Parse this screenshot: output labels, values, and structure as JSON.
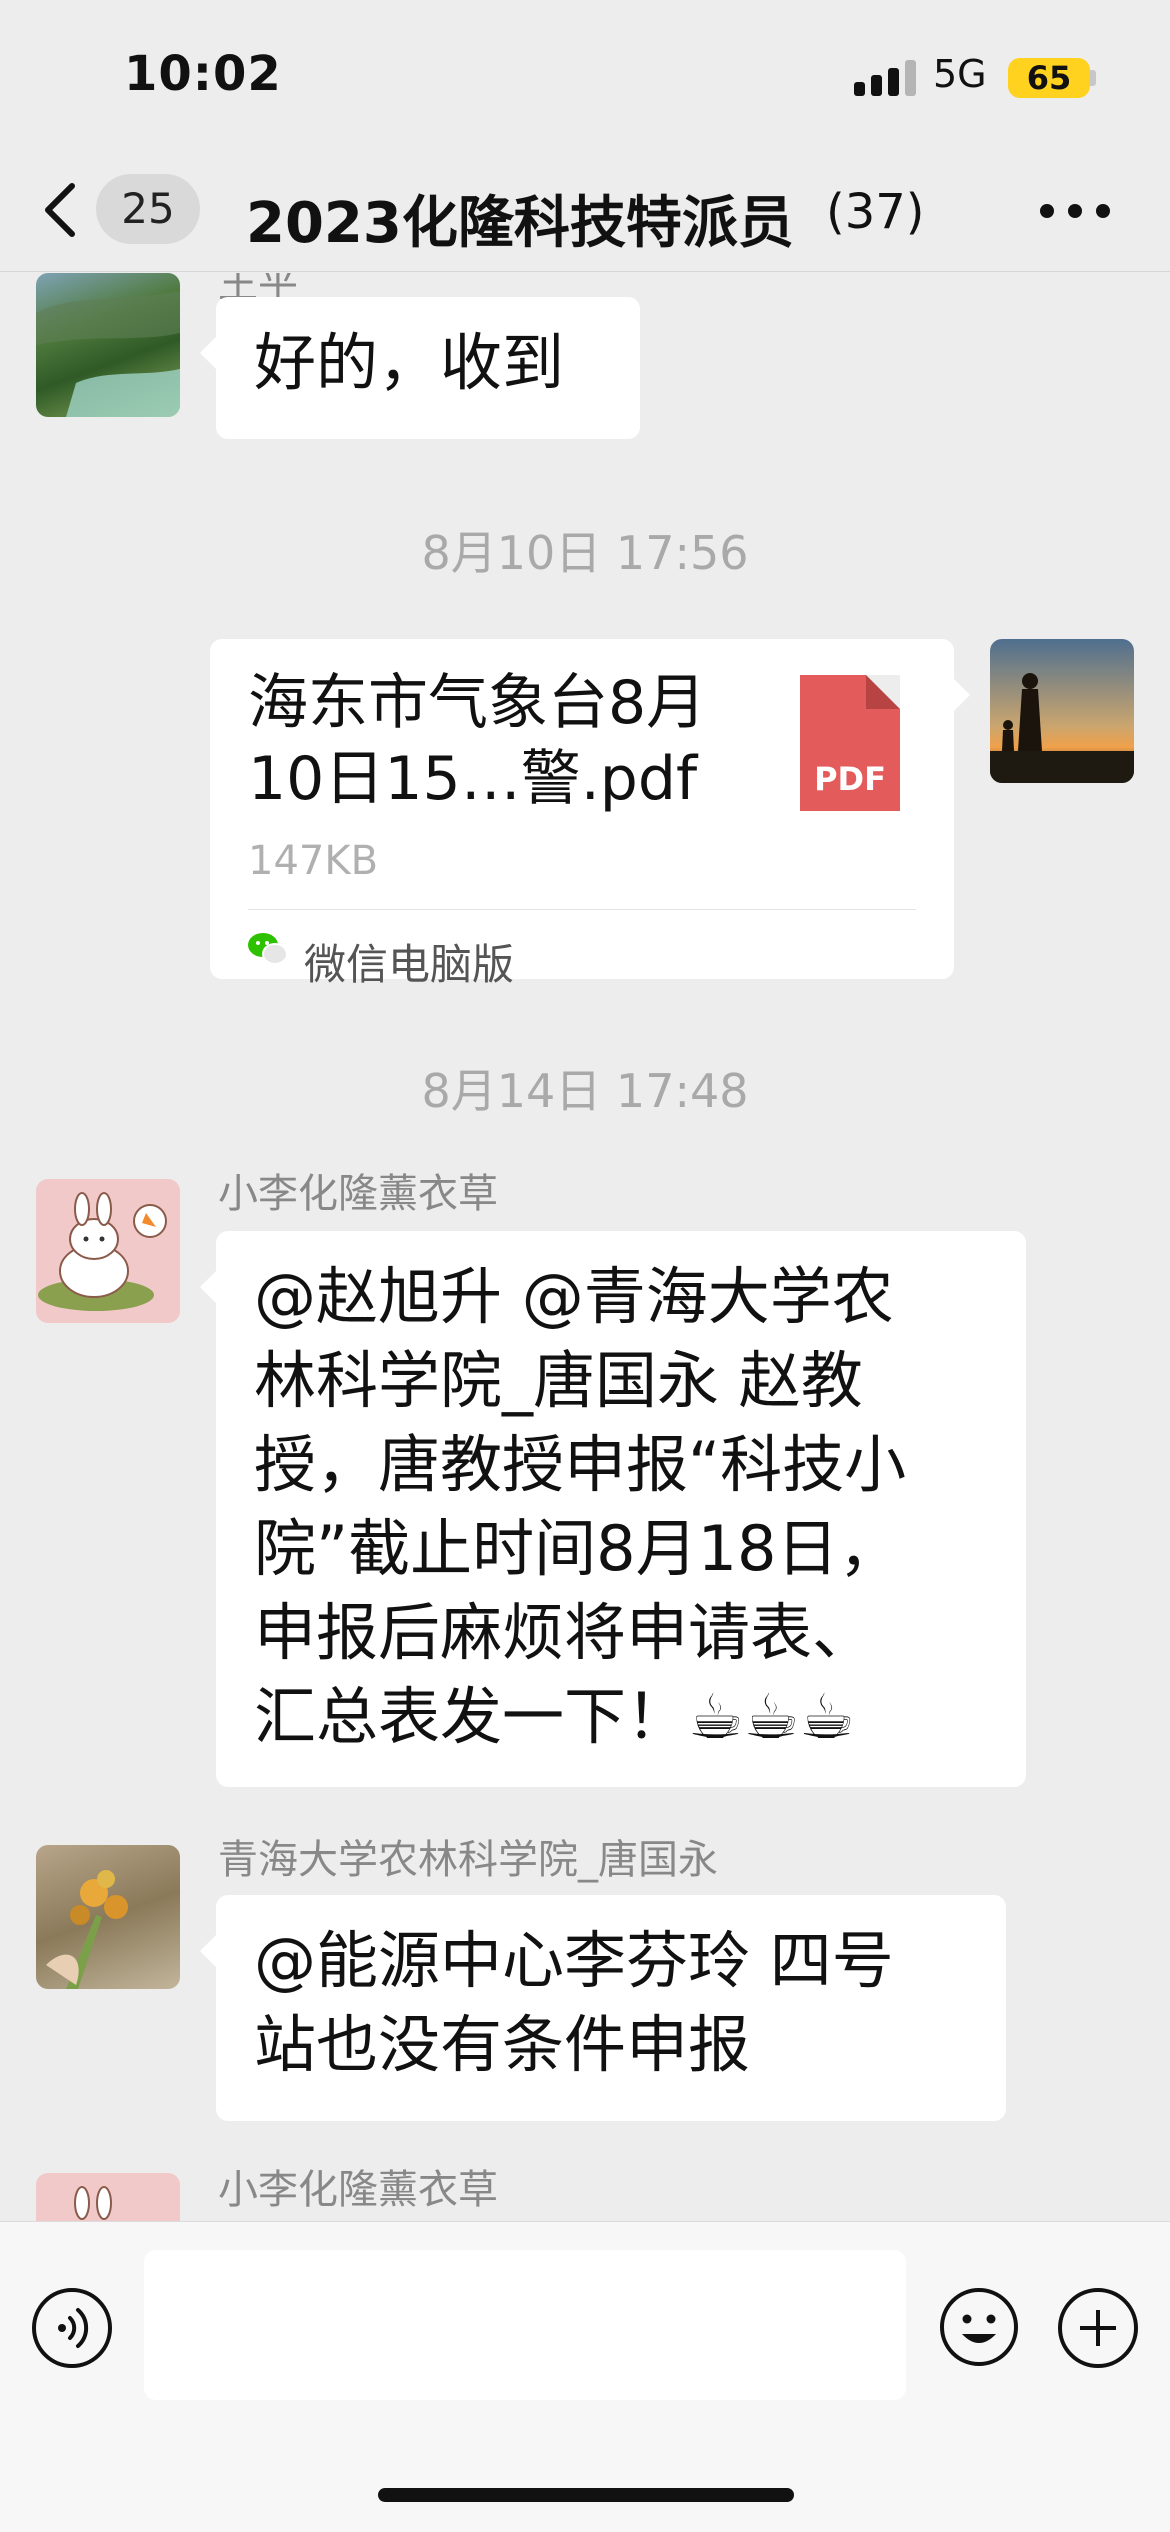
{
  "status_bar": {
    "time": "10:02",
    "network": "5G",
    "battery": "65"
  },
  "nav": {
    "unread_count": "25",
    "title": "2023化隆科技特派员",
    "member_count": "(37)"
  },
  "messages": {
    "top_partial_sender": "王平",
    "msg1_text": "好的，收到",
    "time1": "8月10日 17:56",
    "file": {
      "name": "海东市气象台8月10日15…警.pdf",
      "icon_label": "PDF",
      "size": "147KB",
      "source": "微信电脑版"
    },
    "time2": "8月14日 17:48",
    "msg2_sender": "小李化隆薰衣草",
    "msg2_lines": [
      "@赵旭升 @青海大学农",
      "林科学院_唐国永 赵教",
      "授，唐教授申报“科技小",
      "院”截止时间8月18日，",
      "申报后麻烦将申请表、",
      "汇总表发一下！☕☕☕"
    ],
    "msg3_sender": "青海大学农林科学院_唐国永",
    "msg3_lines": [
      "@能源中心李芬玲 四号",
      "站也没有条件申报"
    ],
    "msg4_sender": "小李化隆薰衣草"
  },
  "colors": {
    "background": "#ededed",
    "bubble": "#ffffff",
    "pdf_red": "#e35b5b",
    "battery_yellow": "#ffd21f"
  },
  "icons": [
    "back-chevron-icon",
    "more-icon",
    "pdf-icon",
    "wechat-icon",
    "voice-icon",
    "emoji-icon",
    "plus-icon"
  ]
}
